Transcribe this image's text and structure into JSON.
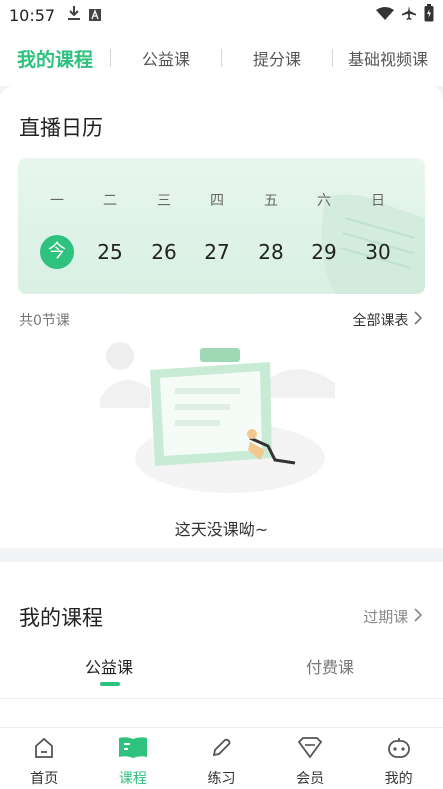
{
  "status_bar": {
    "time": "10:57"
  },
  "top_tabs": [
    {
      "label": "我的课程",
      "active": true
    },
    {
      "label": "公益课",
      "active": false
    },
    {
      "label": "提分课",
      "active": false
    },
    {
      "label": "基础视频课",
      "active": false
    }
  ],
  "calendar": {
    "title": "直播日历",
    "weekdays": [
      "一",
      "二",
      "三",
      "四",
      "五",
      "六",
      "日"
    ],
    "today_label": "今",
    "dates": [
      "25",
      "26",
      "27",
      "28",
      "29",
      "30"
    ],
    "count_text": "共0节课",
    "all_schedule_label": "全部课表",
    "empty_text": "这天没课呦~"
  },
  "my_courses": {
    "title": "我的课程",
    "expired_label": "过期课",
    "tabs": [
      {
        "label": "公益课",
        "active": true
      },
      {
        "label": "付费课",
        "active": false
      }
    ]
  },
  "bottom_nav": [
    {
      "label": "首页",
      "icon": "home-icon",
      "active": false
    },
    {
      "label": "课程",
      "icon": "book-icon",
      "active": true
    },
    {
      "label": "练习",
      "icon": "pencil-icon",
      "active": false
    },
    {
      "label": "会员",
      "icon": "diamond-icon",
      "active": false
    },
    {
      "label": "我的",
      "icon": "robot-face-icon",
      "active": false
    }
  ],
  "colors": {
    "accent": "#2ec27e"
  }
}
